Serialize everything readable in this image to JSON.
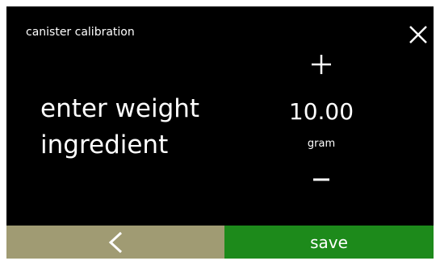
{
  "header": {
    "title": "canister calibration",
    "close_icon": "close-icon"
  },
  "prompt": {
    "line1": "enter weight",
    "line2": "ingredient"
  },
  "stepper": {
    "increase_icon": "plus-icon",
    "decrease_icon": "minus-icon",
    "value": "10.00",
    "unit": "gram"
  },
  "footer": {
    "back_icon": "chevron-left-icon",
    "save_label": "save"
  },
  "colors": {
    "screen_background": "#000000",
    "back_button": "#a09b73",
    "save_button": "#1d8a1b",
    "text": "#ffffff"
  }
}
